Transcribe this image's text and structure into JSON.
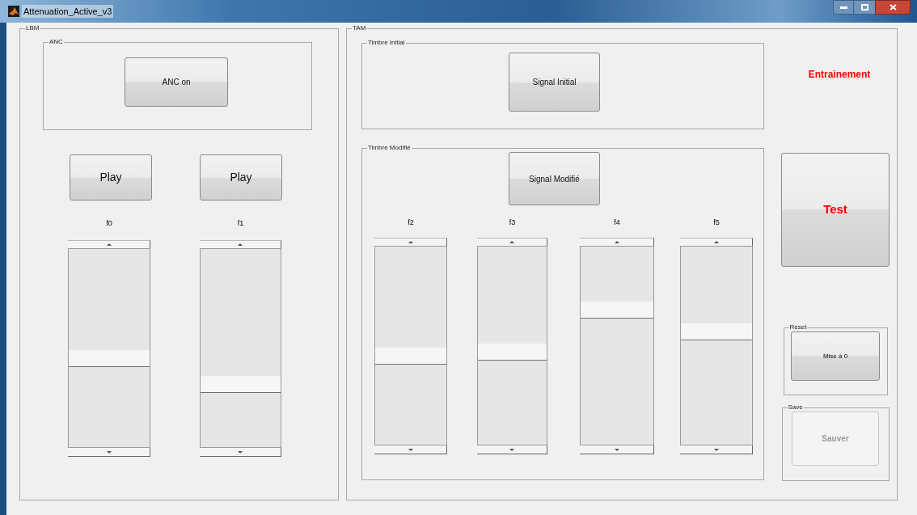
{
  "window": {
    "title": "Attenuation_Active_v3"
  },
  "lbm": {
    "title": "LBM",
    "anc": {
      "title": "ANC",
      "button": "ANC on"
    },
    "play_buttons": [
      "Play",
      "Play"
    ],
    "sliders": [
      {
        "label": "f0",
        "level": 0.45
      },
      {
        "label": "f1",
        "level": 0.31
      }
    ]
  },
  "tam": {
    "title": "TAM",
    "timbre_initial": {
      "title": "Timbre Initial",
      "button": "Signal Initial"
    },
    "timbre_modifie": {
      "title": "Timbre Modifié",
      "button": "Signal Modifié",
      "sliders": [
        {
          "label": "f2",
          "level": 0.45
        },
        {
          "label": "f3",
          "level": 0.47
        },
        {
          "label": "f4",
          "level": 0.7
        },
        {
          "label": "f5",
          "level": 0.58
        }
      ]
    },
    "mode_label": "Entrainement",
    "test_button": "Test",
    "reset": {
      "title": "Reset",
      "button": "Mise à 0"
    },
    "save": {
      "title": "Save",
      "button": "Sauver",
      "disabled": true
    }
  }
}
